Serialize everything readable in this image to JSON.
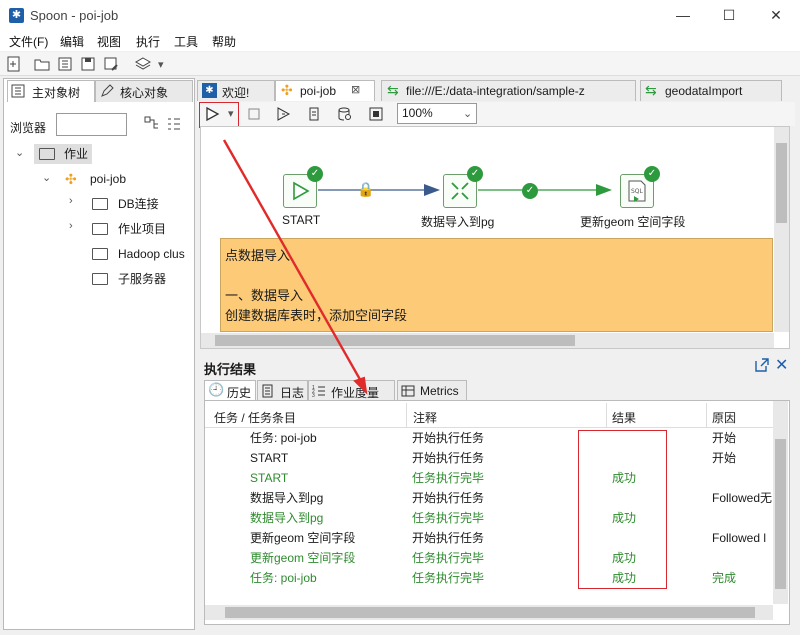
{
  "window": {
    "title": "Spoon - poi-job",
    "minimize": "—",
    "maximize": "☐",
    "close": "✕"
  },
  "menu": [
    "文件(F)",
    "编辑",
    "视图",
    "执行",
    "工具",
    "帮助"
  ],
  "left": {
    "tabs": [
      "主对象树",
      "核心对象"
    ],
    "browser_label": "浏览器",
    "tree": {
      "root": "作业",
      "job": "poi-job",
      "children": [
        "DB连接",
        "作业项目",
        "Hadoop clus",
        "子服务器"
      ]
    }
  },
  "main_tabs": [
    "欢迎!",
    "poi-job",
    "file:///E:/data-integration/sample-z",
    "geodataImport"
  ],
  "zoom": "100%",
  "nodes": {
    "start": "START",
    "import": "数据导入到pg",
    "geom": "更新geom 空间字段"
  },
  "note_text": "点数据导入\n\n一、数据导入\n创建数据库表时，添加空间字段\ngeom geometry",
  "results": {
    "title": "执行结果",
    "tabs": [
      "历史",
      "日志",
      "作业度量",
      "Metrics"
    ],
    "headers": {
      "task": "任务 / 任务条目",
      "comment": "注释",
      "result": "结果",
      "reason": "原因"
    },
    "rows": [
      {
        "task": "任务: poi-job",
        "comment": "开始执行任务",
        "result": "",
        "reason": "开始",
        "green": false
      },
      {
        "task": "START",
        "comment": "开始执行任务",
        "result": "",
        "reason": "开始",
        "green": false
      },
      {
        "task": "START",
        "comment": "任务执行完毕",
        "result": "成功",
        "reason": "",
        "green": true
      },
      {
        "task": "数据导入到pg",
        "comment": "开始执行任务",
        "result": "",
        "reason": "Followed无",
        "green": false
      },
      {
        "task": "数据导入到pg",
        "comment": "任务执行完毕",
        "result": "成功",
        "reason": "",
        "green": true
      },
      {
        "task": "更新geom 空间字段",
        "comment": "开始执行任务",
        "result": "",
        "reason": "Followed l",
        "green": false
      },
      {
        "task": "更新geom 空间字段",
        "comment": "任务执行完毕",
        "result": "成功",
        "reason": "",
        "green": true
      },
      {
        "task": "任务: poi-job",
        "comment": "任务执行完毕",
        "result": "成功",
        "reason": "完成",
        "green": true
      }
    ]
  },
  "colors": {
    "accent_red": "#d8282f",
    "success_green": "#2e9a3e",
    "note_bg": "#fdca77"
  }
}
